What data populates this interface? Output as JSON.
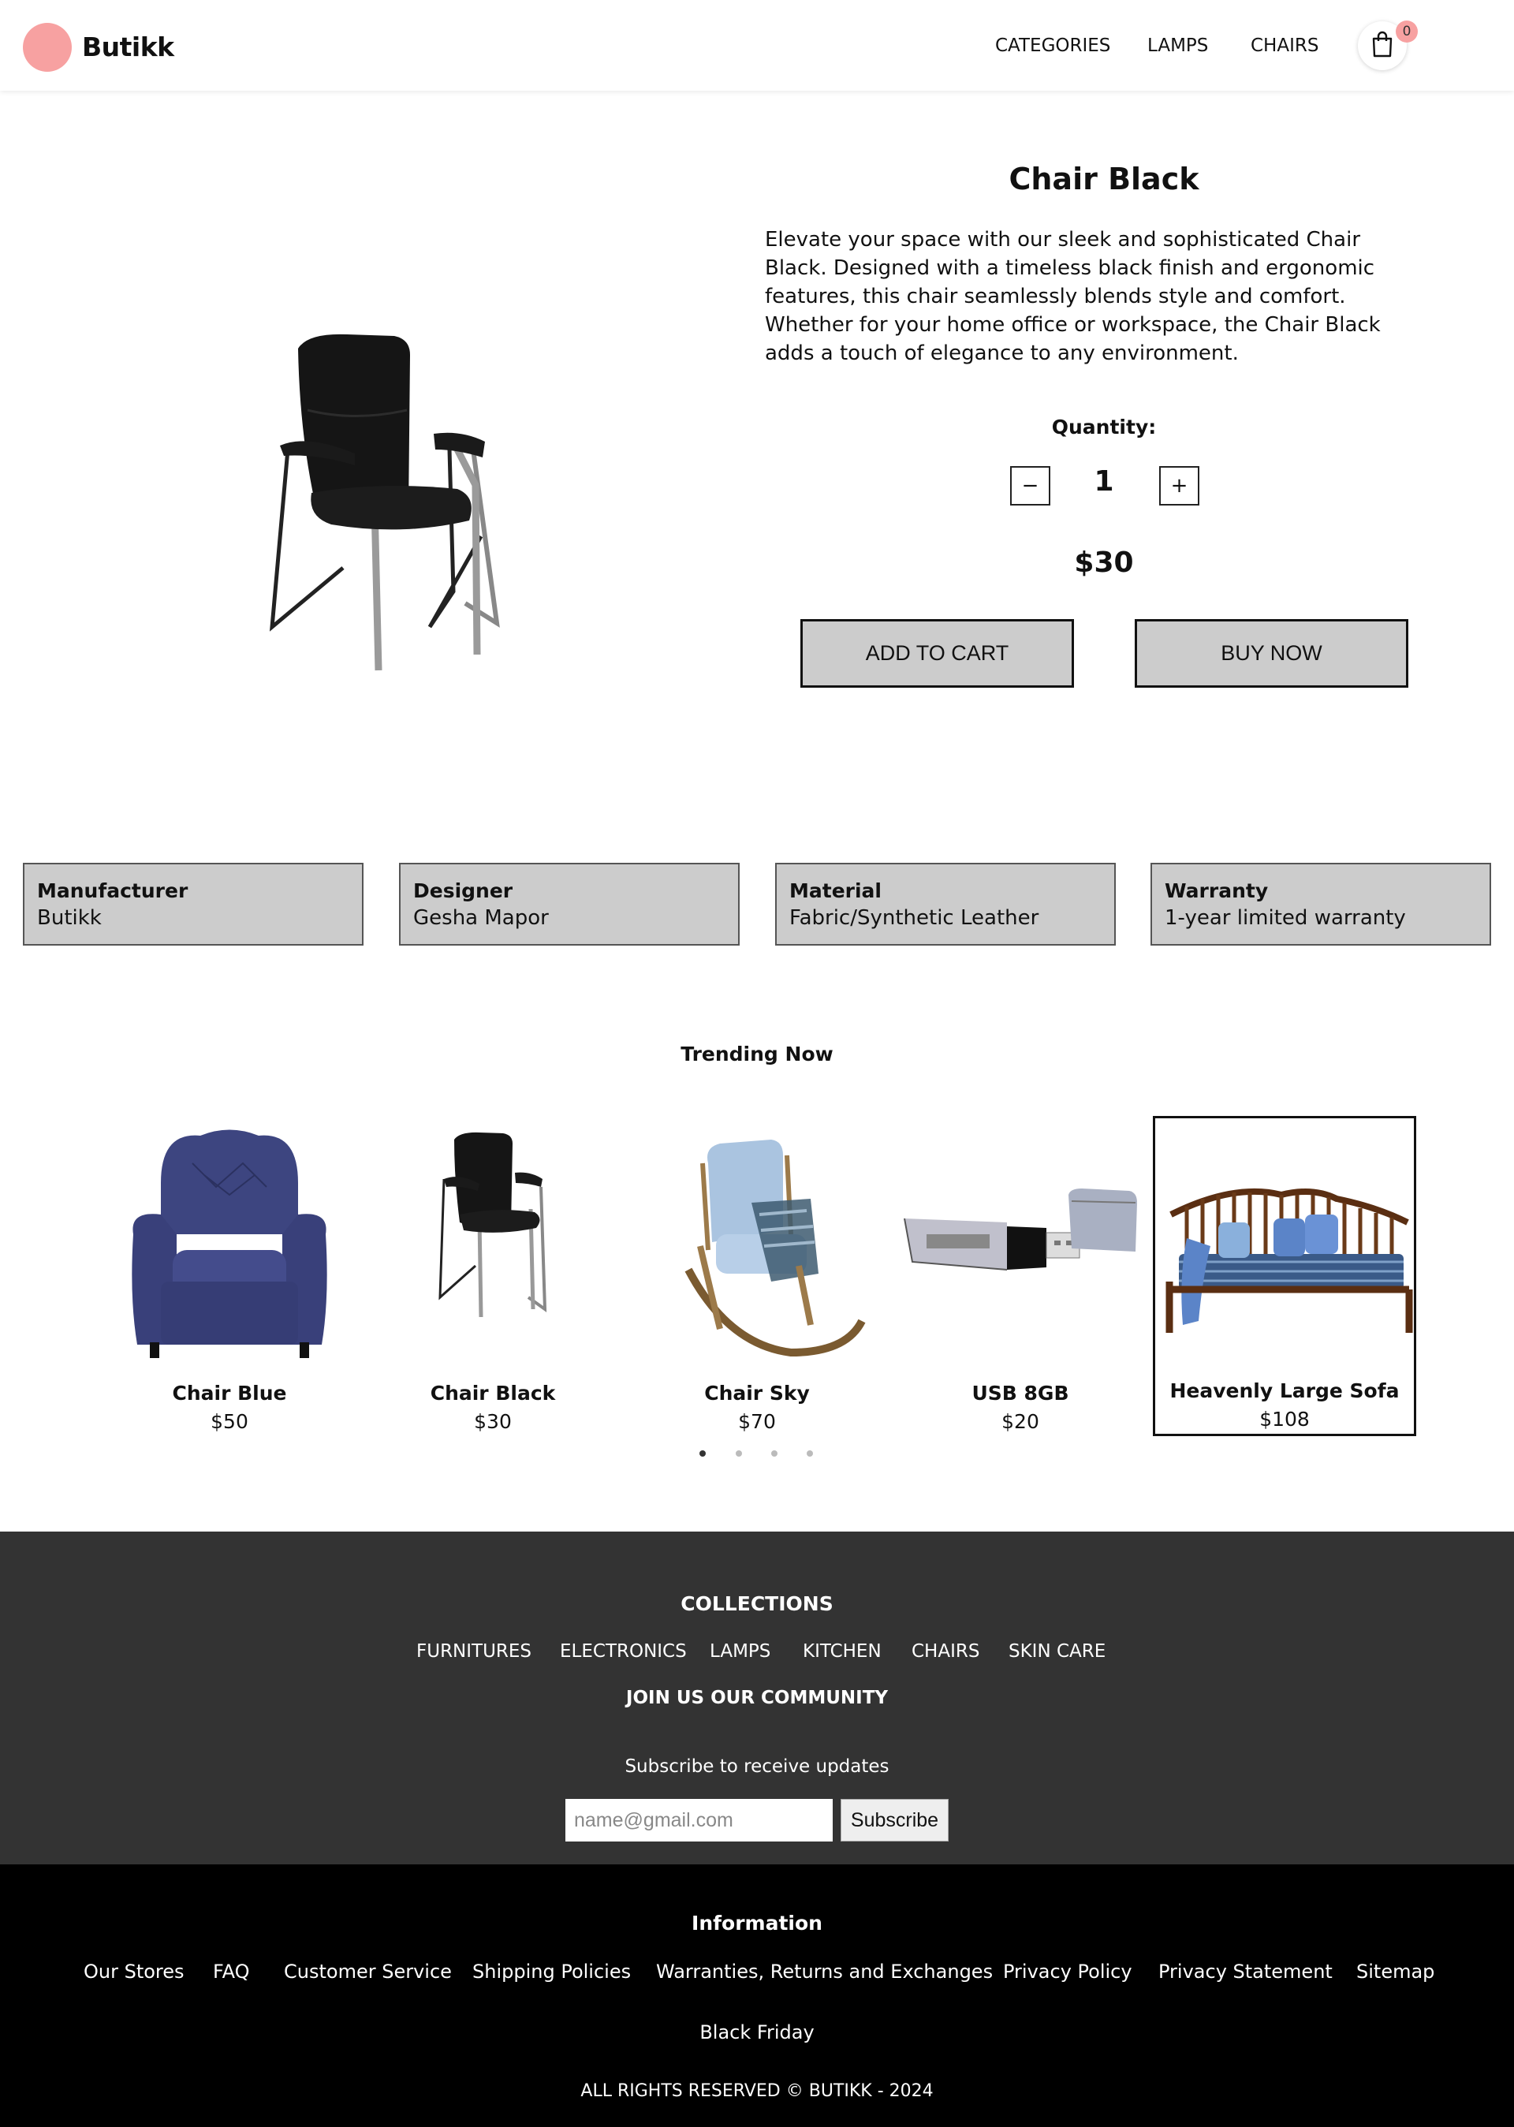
{
  "header": {
    "logo_text": "Butikk",
    "nav": [
      "CATEGORIES",
      "LAMPS",
      "CHAIRS"
    ],
    "cart_count": "0"
  },
  "product": {
    "title": "Chair Black",
    "description": "Elevate your space with our sleek and sophisticated Chair Black. Designed with a timeless black finish and ergonomic features, this chair seamlessly blends style and comfort. Whether for your home office or workspace, the Chair Black adds a touch of elegance to any environment.",
    "quantity_label": "Quantity:",
    "decrement_label": "−",
    "increment_label": "+",
    "quantity": "1",
    "price": "$30",
    "add_to_cart_label": "ADD TO CART",
    "buy_now_label": "BUY NOW"
  },
  "specs": [
    {
      "label": "Manufacturer",
      "value": "Butikk"
    },
    {
      "label": "Designer",
      "value": "Gesha Mapor"
    },
    {
      "label": "Material",
      "value": "Fabric/Synthetic Leather"
    },
    {
      "label": "Warranty",
      "value": "1-year limited warranty"
    }
  ],
  "trending": {
    "title": "Trending Now",
    "items": [
      {
        "name": "Chair Blue",
        "price": "$50"
      },
      {
        "name": "Chair Black",
        "price": "$30"
      },
      {
        "name": "Chair Sky",
        "price": "$70"
      },
      {
        "name": "USB 8GB",
        "price": "$20"
      },
      {
        "name": "Heavenly Large Sofa",
        "price": "$108"
      }
    ],
    "active_dot": 1,
    "dot_count": 4
  },
  "community": {
    "collections_title": "COLLECTIONS",
    "collections": [
      "FURNITURES",
      "ELECTRONICS",
      "LAMPS",
      "KITCHEN",
      "CHAIRS",
      "SKIN CARE"
    ],
    "join_title": "JOIN US OUR COMMUNITY",
    "subscribe_text": "Subscribe to receive updates",
    "email_placeholder": "name@gmail.com",
    "subscribe_label": "Subscribe"
  },
  "info": {
    "title": "Information",
    "links": [
      "Our Stores",
      "FAQ",
      "Customer Service",
      "Shipping Policies",
      "Warranties, Returns and Exchanges",
      "Privacy Policy",
      "Privacy Statement",
      "Sitemap"
    ],
    "black_friday": "Black Friday",
    "copyright": "ALL RIGHTS RESERVED © BUTIKK - 2024"
  },
  "colors": {
    "accent": "#f7a1a1",
    "button_bg": "#cccccc",
    "community_bg": "#333333",
    "info_bg": "#000000"
  }
}
